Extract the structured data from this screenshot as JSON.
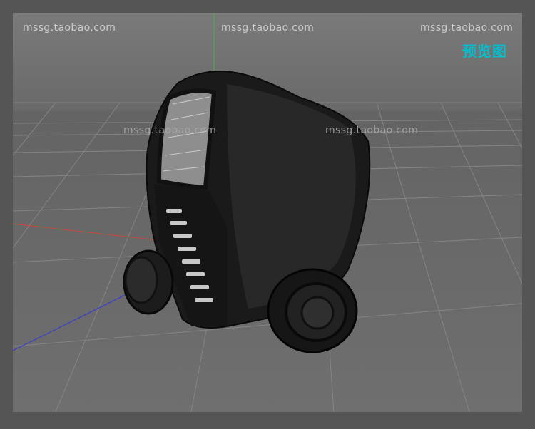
{
  "watermarks": {
    "top_left": "mssg.taobao.com",
    "top_center": "mssg.taobao.com",
    "top_right": "mssg.taobao.com",
    "mid_left": "mssg.taobao.com",
    "mid_right": "mssg.taobao.com"
  },
  "preview_label": "预览图",
  "colors": {
    "accent": "#00bfcf",
    "axis_x": "#c74a3a",
    "axis_y": "#42b842",
    "axis_z": "#3c3ccf",
    "viewport_bg": "#6d6d6d"
  },
  "scene": {
    "object": "gas-mask-wireframe",
    "grid": true
  }
}
